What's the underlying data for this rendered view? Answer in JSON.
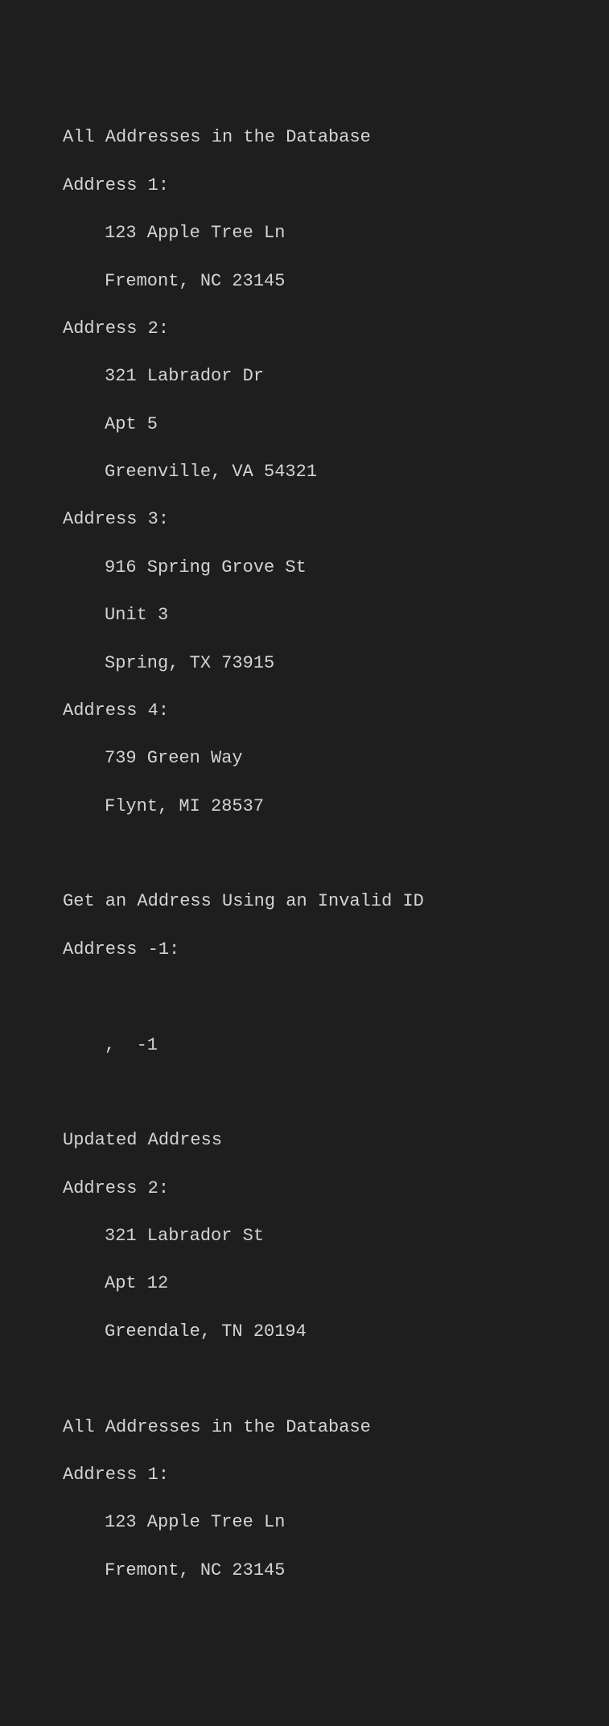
{
  "section1": {
    "title": "All Addresses in the Database",
    "addresses": [
      {
        "label": "Address 1:",
        "lines": [
          "123 Apple Tree Ln",
          "Fremont, NC 23145"
        ]
      },
      {
        "label": "Address 2:",
        "lines": [
          "321 Labrador Dr",
          "Apt 5",
          "Greenville, VA 54321"
        ]
      },
      {
        "label": "Address 3:",
        "lines": [
          "916 Spring Grove St",
          "Unit 3",
          "Spring, TX 73915"
        ]
      },
      {
        "label": "Address 4:",
        "lines": [
          "739 Green Way",
          "Flynt, MI 28537"
        ]
      }
    ]
  },
  "section2": {
    "title": "Get an Address Using an Invalid ID",
    "label": "Address -1:",
    "result": ",  -1"
  },
  "section3": {
    "title": "Updated Address",
    "label": "Address 2:",
    "lines": [
      "321 Labrador St",
      "Apt 12",
      "Greendale, TN 20194"
    ]
  },
  "section4": {
    "title": "All Addresses in the Database",
    "addresses": [
      {
        "label": "Address 1:",
        "lines": [
          "123 Apple Tree Ln",
          "Fremont, NC 23145"
        ]
      }
    ]
  }
}
